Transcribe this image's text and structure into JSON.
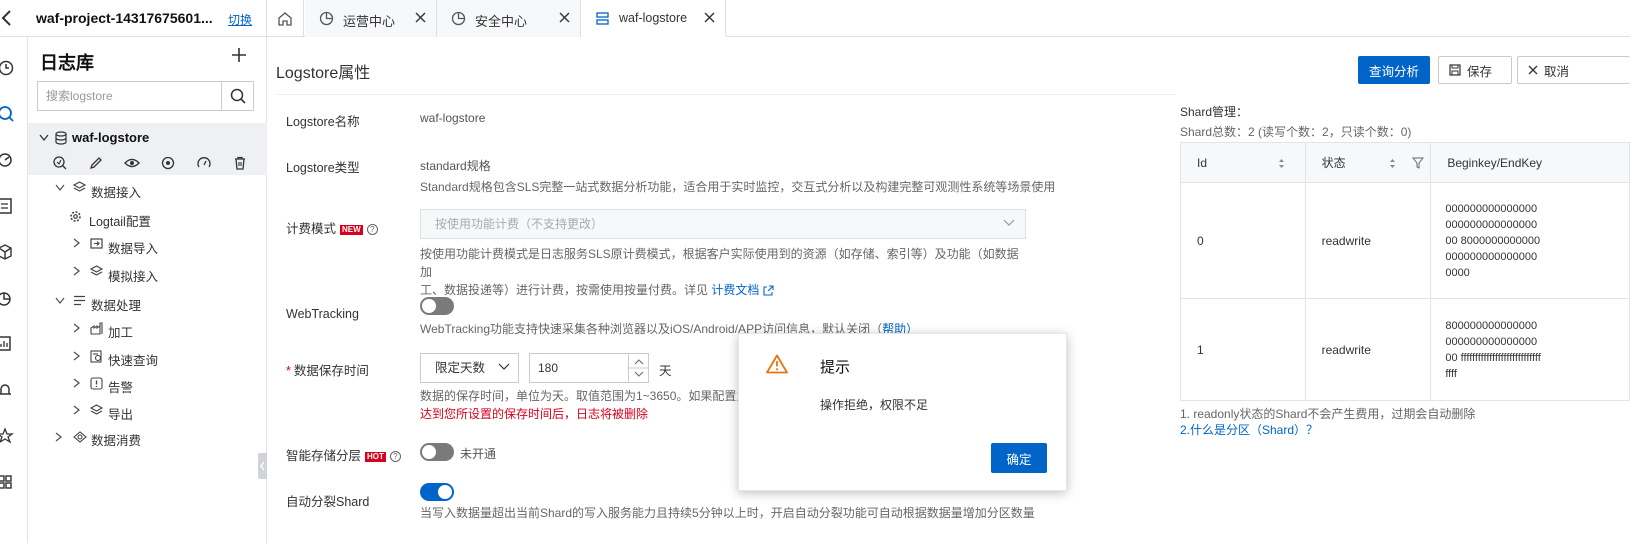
{
  "header": {
    "project": "waf-project-14317675601...",
    "switch_label": "切换",
    "tabs": [
      {
        "label": "运营中心"
      },
      {
        "label": "安全中心"
      },
      {
        "label": "waf-logstore"
      }
    ]
  },
  "sidebar": {
    "title": "日志库",
    "search_placeholder": "搜索logstore",
    "logstore_name": "waf-logstore",
    "tree": [
      {
        "label": "数据接入"
      },
      {
        "label": "Logtail配置"
      },
      {
        "label": "数据导入"
      },
      {
        "label": "模拟接入"
      },
      {
        "label": "数据处理"
      },
      {
        "label": "加工"
      },
      {
        "label": "快速查询"
      },
      {
        "label": "告警"
      },
      {
        "label": "导出"
      },
      {
        "label": "数据消费"
      }
    ]
  },
  "main": {
    "title": "Logstore属性",
    "buttons": {
      "query": "查询分析",
      "save": "保存",
      "cancel": "取消"
    },
    "fields": {
      "name_label": "Logstore名称",
      "name_value": "waf-logstore",
      "type_label": "Logstore类型",
      "type_value": "standard规格",
      "type_desc": "Standard规格包含SLS完整一站式数据分析功能，适合用于实时监控，交互式分析以及构建完整可观测性系统等场景使用",
      "billing_label": "计费模式",
      "billing_badge": "NEW",
      "billing_placeholder": "按使用功能计费（不支持更改）",
      "billing_desc_1": "按使用功能计费模式是日志服务SLS原计费模式，根据客户实际使用到的资源（如存储、索引等）及功能（如数据加",
      "billing_desc_2": "工、数据投递等）进行计费，按需使用按量付费。详见",
      "billing_link": "计费文档",
      "webtracking_label": "WebTracking",
      "webtracking_desc": "WebTracking功能支持快速采集各种浏览器以及iOS/Android/APP访问信息，默认关闭（",
      "webtracking_help": "帮助）",
      "retention_label": "数据保存时间",
      "retention_mode": "限定天数",
      "retention_value": "180",
      "retention_unit": "天",
      "retention_desc": "数据的保存时间，单位为天。取值范围为1~3650。如果配置为",
      "retention_warn": "达到您所设置的保存时间后，日志将被删除",
      "tiering_label": "智能存储分层",
      "tiering_badge": "HOT",
      "tiering_status": "未开通",
      "autosplit_label": "自动分裂Shard",
      "autosplit_desc": "当写入数据量超出当前Shard的写入服务能力且持续5分钟以上时，开启自动分裂功能可自动根据数据量增加分区数量"
    }
  },
  "shard": {
    "title": "Shard管理：",
    "summary": "Shard总数：2   (读写个数：2，只读个数：0)",
    "columns": [
      "Id",
      "状态",
      "Beginkey/EndKey"
    ],
    "rows": [
      {
        "id": "0",
        "status": "readwrite",
        "keys": "00000000000000000000000000000000 80000000000000000000000000000000"
      },
      {
        "id": "1",
        "status": "readwrite",
        "keys": "80000000000000000000000000000000 ffffffffffffffffffffffffffffffff"
      }
    ],
    "note": "1. readonly状态的Shard不会产生费用，过期会自动删除",
    "link": "2.什么是分区（Shard）？"
  },
  "dialog": {
    "title": "提示",
    "message": "操作拒绝，权限不足",
    "ok": "确定"
  },
  "colors": {
    "primary": "#0064c8",
    "warning": "#e8740c",
    "danger": "#d9001b"
  }
}
